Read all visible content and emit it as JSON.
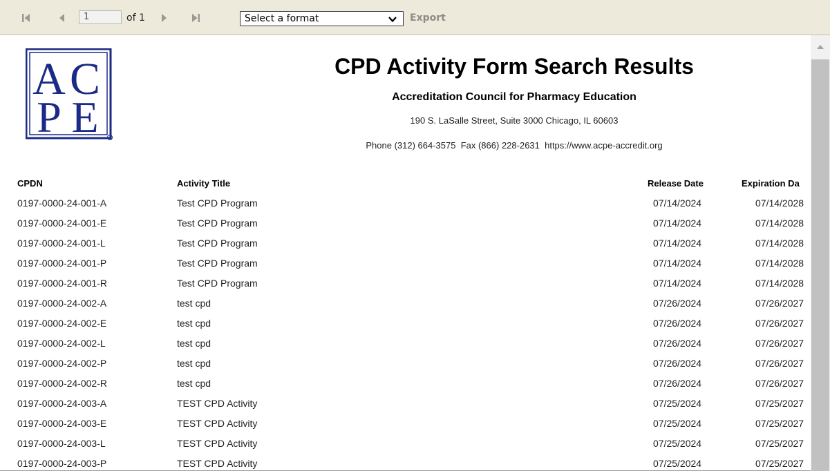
{
  "toolbar": {
    "page_number": "1",
    "page_of": "of 1",
    "format_select": "Select a format",
    "export_label": "Export"
  },
  "header": {
    "logo_text": "ACPE",
    "title": "CPD Activity Form Search Results",
    "organization": "Accreditation Council for Pharmacy Education",
    "address": "190 S. LaSalle Street, Suite 3000 Chicago, IL 60603",
    "contact": "Phone (312) 664-3575  Fax (866) 228-2631  https://www.acpe-accredit.org"
  },
  "table": {
    "columns": {
      "cpdn": "CPDN",
      "title": "Activity Title",
      "release": "Release Date",
      "expiration": "Expiration Da"
    },
    "rows": [
      {
        "cpdn": "0197-0000-24-001-A",
        "title": "Test CPD Program",
        "release": "07/14/2024",
        "expiration": "07/14/2028"
      },
      {
        "cpdn": "0197-0000-24-001-E",
        "title": "Test CPD Program",
        "release": "07/14/2024",
        "expiration": "07/14/2028"
      },
      {
        "cpdn": "0197-0000-24-001-L",
        "title": "Test CPD Program",
        "release": "07/14/2024",
        "expiration": "07/14/2028"
      },
      {
        "cpdn": "0197-0000-24-001-P",
        "title": "Test CPD Program",
        "release": "07/14/2024",
        "expiration": "07/14/2028"
      },
      {
        "cpdn": "0197-0000-24-001-R",
        "title": "Test CPD Program",
        "release": "07/14/2024",
        "expiration": "07/14/2028"
      },
      {
        "cpdn": "0197-0000-24-002-A",
        "title": "test cpd",
        "release": "07/26/2024",
        "expiration": "07/26/2027"
      },
      {
        "cpdn": "0197-0000-24-002-E",
        "title": "test cpd",
        "release": "07/26/2024",
        "expiration": "07/26/2027"
      },
      {
        "cpdn": "0197-0000-24-002-L",
        "title": "test cpd",
        "release": "07/26/2024",
        "expiration": "07/26/2027"
      },
      {
        "cpdn": "0197-0000-24-002-P",
        "title": "test cpd",
        "release": "07/26/2024",
        "expiration": "07/26/2027"
      },
      {
        "cpdn": "0197-0000-24-002-R",
        "title": "test cpd",
        "release": "07/26/2024",
        "expiration": "07/26/2027"
      },
      {
        "cpdn": "0197-0000-24-003-A",
        "title": "TEST CPD Activity",
        "release": "07/25/2024",
        "expiration": "07/25/2027"
      },
      {
        "cpdn": "0197-0000-24-003-E",
        "title": "TEST CPD Activity",
        "release": "07/25/2024",
        "expiration": "07/25/2027"
      },
      {
        "cpdn": "0197-0000-24-003-L",
        "title": "TEST CPD Activity",
        "release": "07/25/2024",
        "expiration": "07/25/2027"
      },
      {
        "cpdn": "0197-0000-24-003-P",
        "title": "TEST CPD Activity",
        "release": "07/25/2024",
        "expiration": "07/25/2027"
      }
    ]
  },
  "colors": {
    "toolbar_bg": "#eeeadb",
    "logo_blue": "#1b2a86",
    "disabled_gray": "#8d8d86"
  },
  "icons": [
    "first-page-icon",
    "previous-page-icon",
    "next-page-icon",
    "last-page-icon",
    "chevron-down-icon",
    "scroll-up-icon"
  ]
}
